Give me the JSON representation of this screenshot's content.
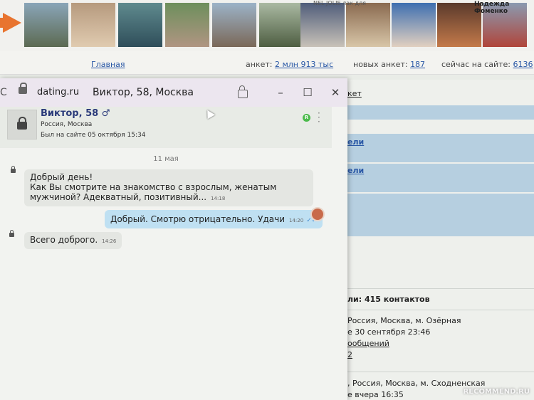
{
  "photostrip": {
    "ticker": "NEL JOLIE лак для",
    "name_tag": "Надежда Фоменко"
  },
  "stats": {
    "main_link": "Главная",
    "ankets_label": "анкет:",
    "ankets_value": "2 млн 913 тыс",
    "new_label": "новых анкет:",
    "new_value": "187",
    "online_label": "сейчас на сайте:",
    "online_value": "6136"
  },
  "right": {
    "anket_frag": "кет",
    "link1": "ели",
    "link2": "ели",
    "contacts": "ли: 415 контактов",
    "loc1": "Россия, Москва, м. Озёрная",
    "seen1": "е 30 сентября 23:46",
    "msgs": "ообщений",
    "num": "2",
    "loc2": ", Россия, Москва, м. Сходненская",
    "seen2": "е вчера 16:35"
  },
  "watermark": "RECOMMEND.RU",
  "chat": {
    "reload": "C",
    "url": "dating.ru",
    "title": "Виктор, 58, Москва",
    "profile": {
      "name": "Виктор, 58 ♂",
      "location": "Россия, Москва",
      "last_seen": "Был на сайте 05 октября 15:34",
      "online_badge": "R"
    },
    "date": "11 мая",
    "messages": [
      {
        "line1": "Добрый день!",
        "line2": "Как Вы смотрите на знакомство с взрослым, женатым",
        "line3": "мужчиной? Адекватный, позитивный...",
        "time": "14:18"
      },
      {
        "text": "Добрый. Смотрю отрицательно. Удачи",
        "time": "14:20"
      },
      {
        "text": "Всего доброго.",
        "time": "14:26"
      }
    ]
  }
}
